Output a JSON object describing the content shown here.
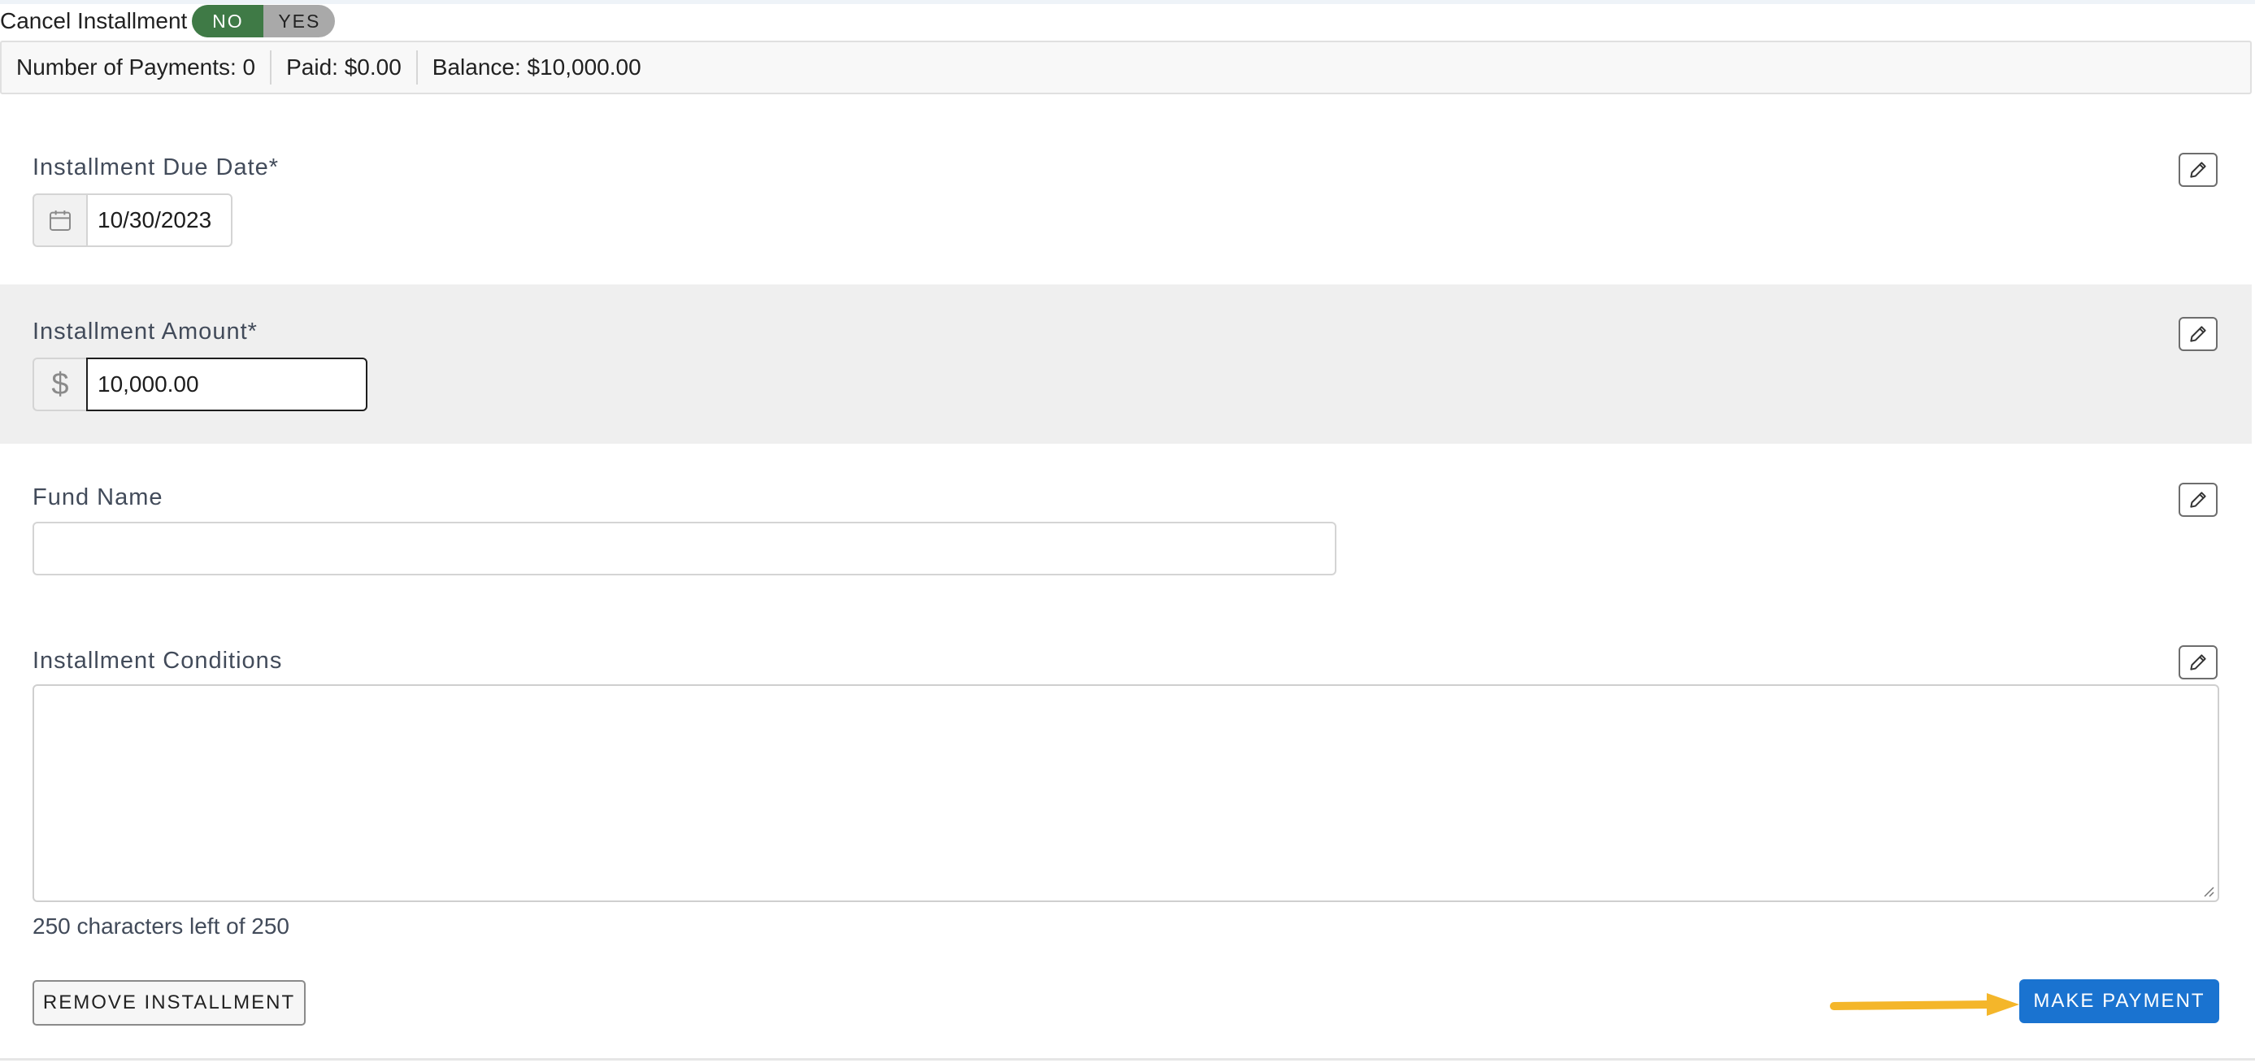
{
  "cancel_installment": {
    "label": "Cancel Installment",
    "options": [
      "NO",
      "YES"
    ],
    "selected": "NO"
  },
  "summary": {
    "payments": "Number of Payments: 0",
    "paid": "Paid: $0.00",
    "balance": "Balance: $10,000.00"
  },
  "fields": {
    "due_date": {
      "label": "Installment Due Date*",
      "value": "10/30/2023",
      "icon": "calendar-icon"
    },
    "amount": {
      "label": "Installment Amount*",
      "prefix": "$",
      "value": "10,000.00"
    },
    "fund_name": {
      "label": "Fund Name",
      "value": ""
    },
    "conditions": {
      "label": "Installment Conditions",
      "value": "",
      "char_count": "250 characters left of 250"
    }
  },
  "actions": {
    "remove": "REMOVE INSTALLMENT",
    "make_payment": "MAKE PAYMENT"
  },
  "colors": {
    "toggle_active": "#3f7a46",
    "toggle_inactive": "#a9a9a9",
    "primary": "#1a73d0",
    "annotation_arrow": "#f4b62a",
    "shaded_row": "#efefef"
  }
}
